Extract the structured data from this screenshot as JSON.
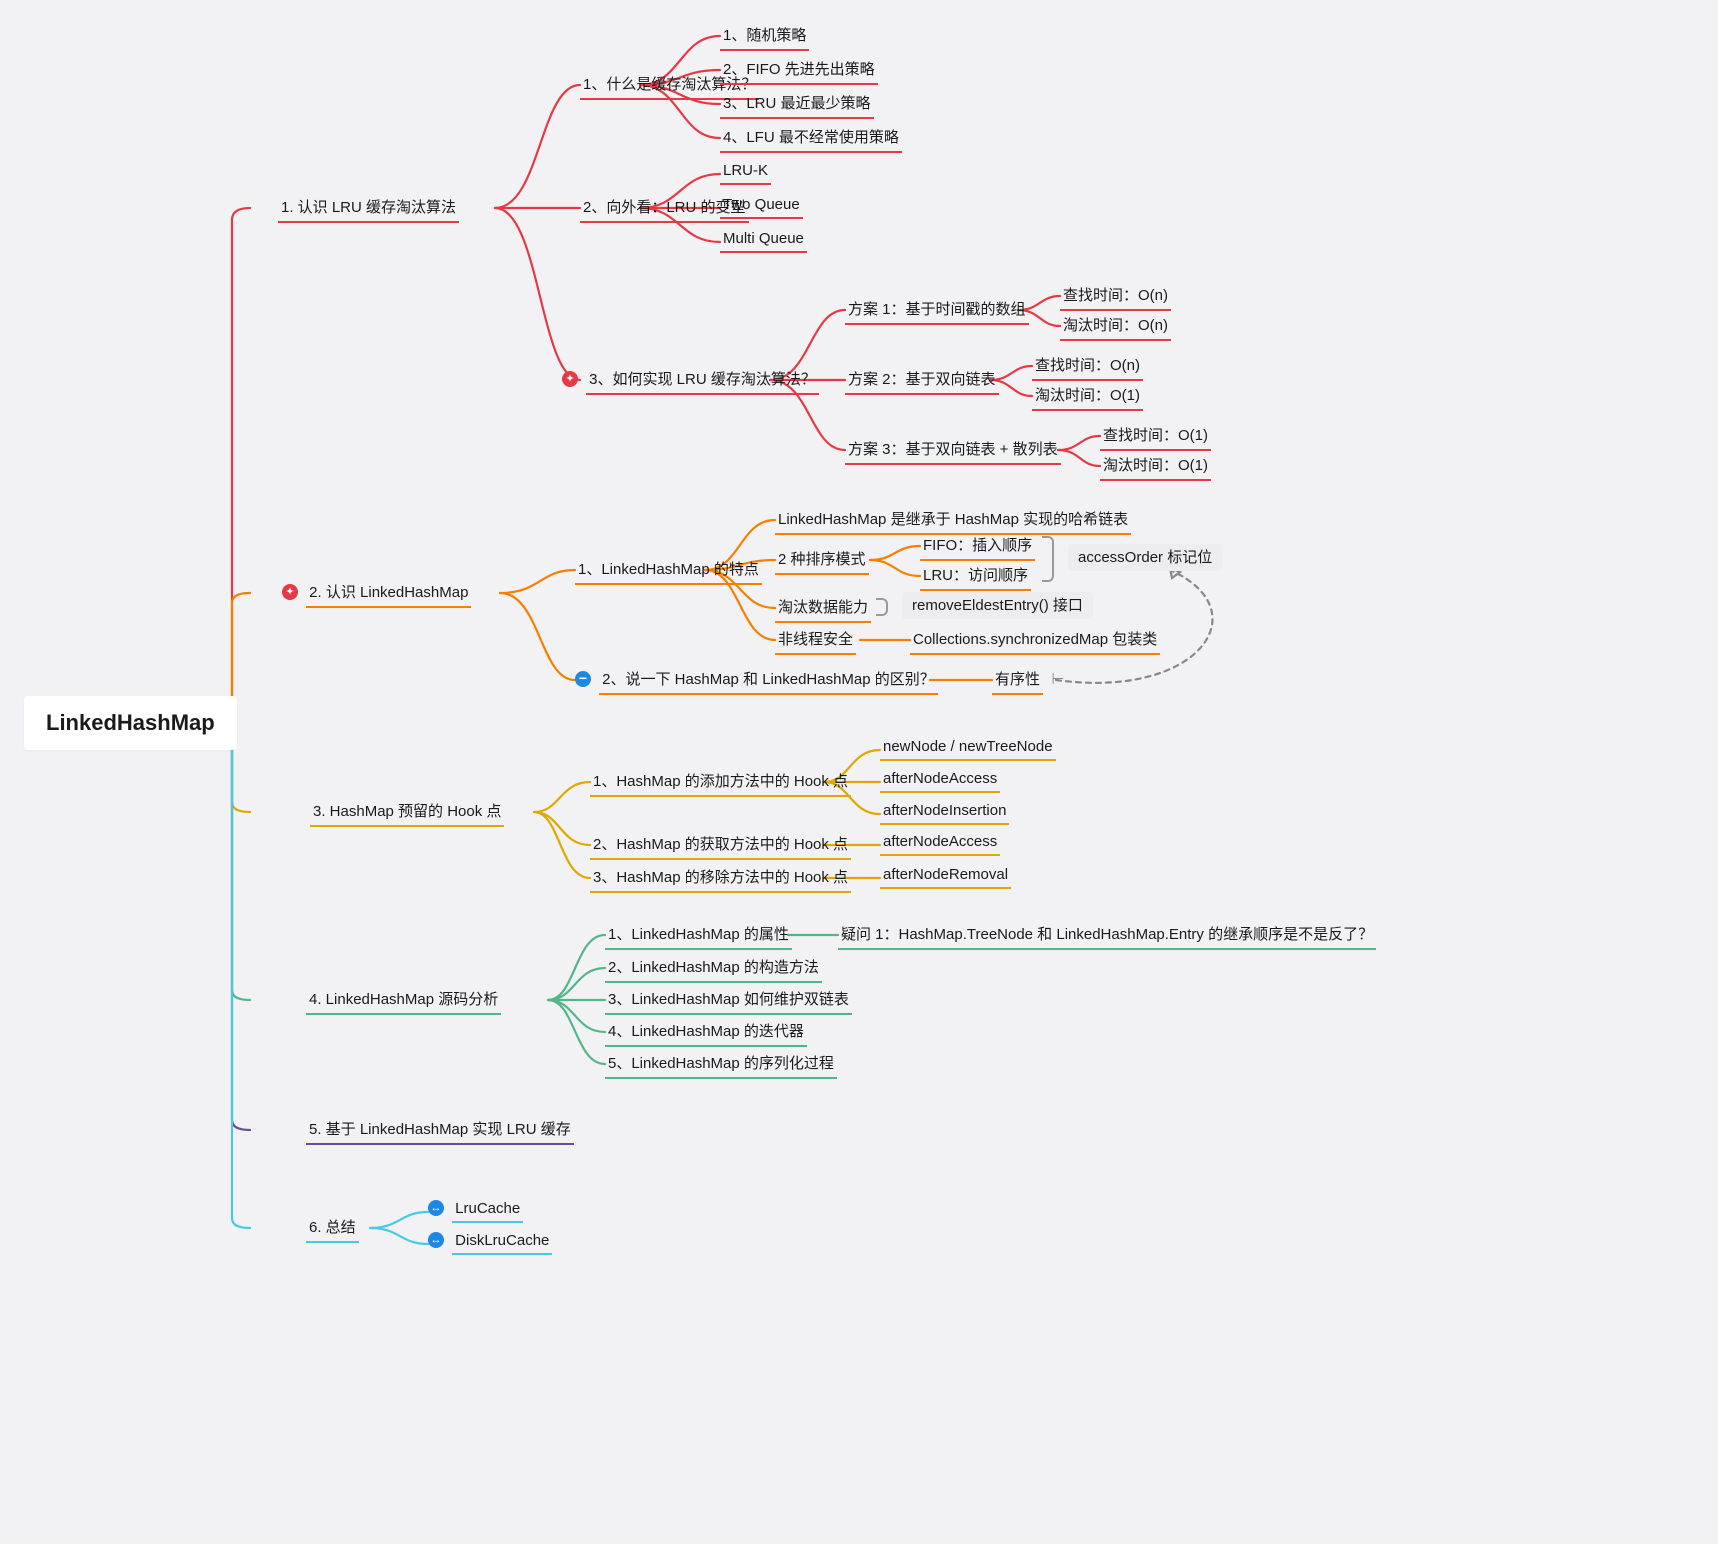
{
  "root": "LinkedHashMap",
  "b1": {
    "title": "1. 认识 LRU 缓存淘汰算法",
    "c1": "1、什么是缓存淘汰算法？",
    "c1_1": "1、随机策略",
    "c1_2": "2、FIFO 先进先出策略",
    "c1_3": "3、LRU 最近最少策略",
    "c1_4": "4、LFU 最不经常使用策略",
    "c2": "2、向外看：LRU 的变型",
    "c2_1": "LRU-K",
    "c2_2": "Two Queue",
    "c2_3": "Multi Queue",
    "c3": "3、如何实现 LRU 缓存淘汰算法？",
    "c3_1": "方案 1：基于时间戳的数组",
    "c3_1a": "查找时间：O(n)",
    "c3_1b": "淘汰时间：O(n)",
    "c3_2": "方案 2：基于双向链表",
    "c3_2a": "查找时间：O(n)",
    "c3_2b": "淘汰时间：O(1)",
    "c3_3": "方案 3：基于双向链表 + 散列表",
    "c3_3a": "查找时间：O(1)",
    "c3_3b": "淘汰时间：O(1)"
  },
  "b2": {
    "title": "2. 认识 LinkedHashMap",
    "c1": "1、LinkedHashMap 的特点",
    "c1_1": "LinkedHashMap 是继承于 HashMap 实现的哈希链表",
    "c1_2": "2 种排序模式",
    "c1_2a": "FIFO：插入顺序",
    "c1_2b": "LRU：访问顺序",
    "c1_3": "淘汰数据能力",
    "c1_4": "非线程安全",
    "c1_4a": "Collections.synchronizedMap 包装类",
    "c2": "2、说一下 HashMap 和 LinkedHashMap 的区别？",
    "c2a": "有序性",
    "tag1": "accessOrder 标记位",
    "tag2": "removeEldestEntry() 接口"
  },
  "b3": {
    "title": "3. HashMap 预留的 Hook 点",
    "c1": "1、HashMap 的添加方法中的 Hook 点",
    "c1_1": "newNode / newTreeNode",
    "c1_2": "afterNodeAccess",
    "c1_3": "afterNodeInsertion",
    "c2": "2、HashMap 的获取方法中的 Hook 点",
    "c2_1": "afterNodeAccess",
    "c3": "3、HashMap 的移除方法中的 Hook 点",
    "c3_1": "afterNodeRemoval"
  },
  "b4": {
    "title": "4. LinkedHashMap 源码分析",
    "c1": "1、LinkedHashMap 的属性",
    "c1_1": "疑问 1：HashMap.TreeNode 和 LinkedHashMap.Entry 的继承顺序是不是反了？",
    "c2": "2、LinkedHashMap 的构造方法",
    "c3": "3、LinkedHashMap 如何维护双链表",
    "c4": "4、LinkedHashMap 的迭代器",
    "c5": "5、LinkedHashMap 的序列化过程"
  },
  "b5": {
    "title": "5. 基于 LinkedHashMap 实现 LRU 缓存"
  },
  "b6": {
    "title": "6. 总结",
    "c1": "LruCache",
    "c2": "DiskLruCache"
  },
  "colors": {
    "red": "#e63946",
    "orange": "#f77f00",
    "yellow": "#e0a800",
    "green": "#52b788",
    "purple": "#6a4c93",
    "cyan": "#48cae4",
    "trunk": "#2aa0de"
  }
}
